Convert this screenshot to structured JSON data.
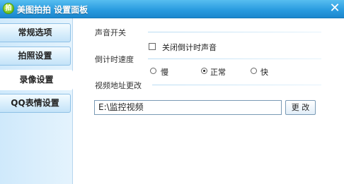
{
  "window": {
    "title": "美图拍拍 设置面板",
    "logo_text": "拍",
    "close_glyph": "✕"
  },
  "sidebar": {
    "items": [
      {
        "label": "常规选项"
      },
      {
        "label": "拍照设置"
      },
      {
        "label": "录像设置",
        "active": true
      },
      {
        "label": "QQ表情设置"
      }
    ]
  },
  "sound": {
    "section_label": "声音开关",
    "mute_option_label": "关闭倒计时声音",
    "mute_checked": false
  },
  "countdown": {
    "section_label": "倒计时速度",
    "options": [
      {
        "label": "慢",
        "checked": false
      },
      {
        "label": "正常",
        "checked": true
      },
      {
        "label": "快",
        "checked": false
      }
    ]
  },
  "video_path": {
    "section_label": "视频地址更改",
    "value": "E:\\监控视频",
    "change_button_label": "更 改"
  },
  "colors": {
    "titlebar": "#2a9ce0",
    "sidebar_bg": "#d6edfb",
    "accent_border": "#8fc1e6"
  }
}
